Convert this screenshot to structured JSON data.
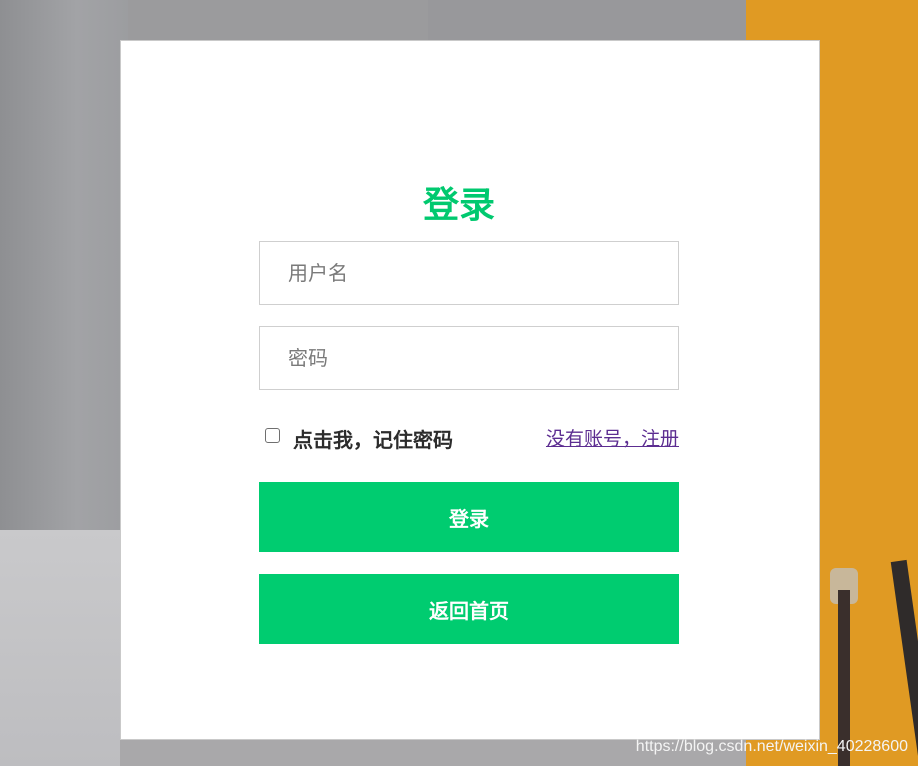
{
  "form": {
    "title": "登录",
    "username_placeholder": "用户名",
    "password_placeholder": "密码",
    "remember_label": "点击我，记住密码",
    "remember_checked": false,
    "register_link": "没有账号，注册",
    "login_button": "登录",
    "home_button": "返回首页"
  },
  "watermark": "https://blog.csdn.net/weixin_40228600",
  "colors": {
    "accent": "#00cc70",
    "title": "#00c96f",
    "link": "#5c2d91",
    "background_right": "#e09a23"
  }
}
